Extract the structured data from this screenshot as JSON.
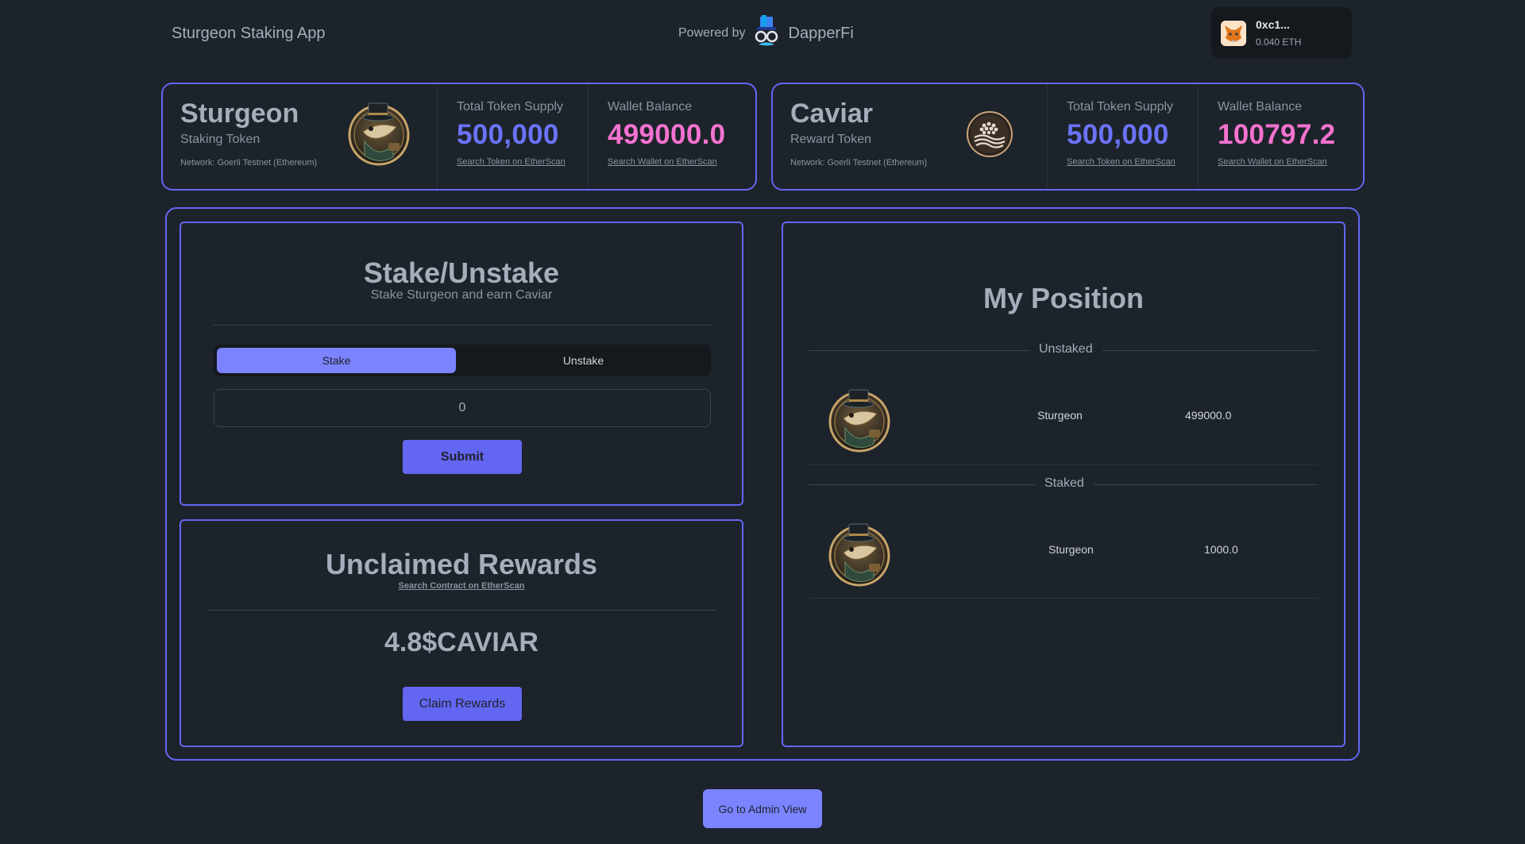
{
  "header": {
    "app_title": "Sturgeon Staking App",
    "powered_by": "Powered by",
    "brand": "DapperFi",
    "wallet": {
      "address": "0xc1...",
      "balance": "0.040 ETH"
    }
  },
  "tokens": [
    {
      "name": "Sturgeon",
      "role": "Staking Token",
      "network": "Network: Goerli Testnet (Ethereum)",
      "supply_label": "Total Token Supply",
      "supply": "500,000",
      "supply_link": "Search Token on EtherScan",
      "balance_label": "Wallet Balance",
      "balance": "499000.0",
      "balance_link": "Search Wallet on EtherScan"
    },
    {
      "name": "Caviar",
      "role": "Reward Token",
      "network": "Network: Goerli Testnet (Ethereum)",
      "supply_label": "Total Token Supply",
      "supply": "500,000",
      "supply_link": "Search Token on EtherScan",
      "balance_label": "Wallet Balance",
      "balance": "100797.2",
      "balance_link": "Search Wallet on EtherScan"
    }
  ],
  "stake_panel": {
    "title": "Stake/Unstake",
    "subtitle": "Stake Sturgeon and earn Caviar",
    "tabs": [
      "Stake",
      "Unstake"
    ],
    "active_tab": "Stake",
    "amount_value": "0",
    "submit_label": "Submit"
  },
  "rewards_panel": {
    "title": "Unclaimed Rewards",
    "contract_link": "Search Contract on EtherScan",
    "amount": "4.8$CAVIAR",
    "claim_label": "Claim Rewards"
  },
  "position_panel": {
    "title": "My Position",
    "sections": [
      {
        "label": "Unstaked",
        "token": "Sturgeon",
        "amount": "499000.0"
      },
      {
        "label": "Staked",
        "token": "Sturgeon",
        "amount": "1000.0"
      }
    ]
  },
  "footer": {
    "admin_label": "Go to Admin View"
  },
  "colors": {
    "accent": "#6366f1",
    "accent_light": "#7b83ff",
    "supply_blue": "#6b73f8",
    "balance_pink": "#f472d0",
    "background": "#1d232a"
  },
  "icons": [
    "sturgeon-coin-icon",
    "caviar-coin-icon",
    "dapperfi-logo-icon",
    "metamask-fox-icon"
  ]
}
